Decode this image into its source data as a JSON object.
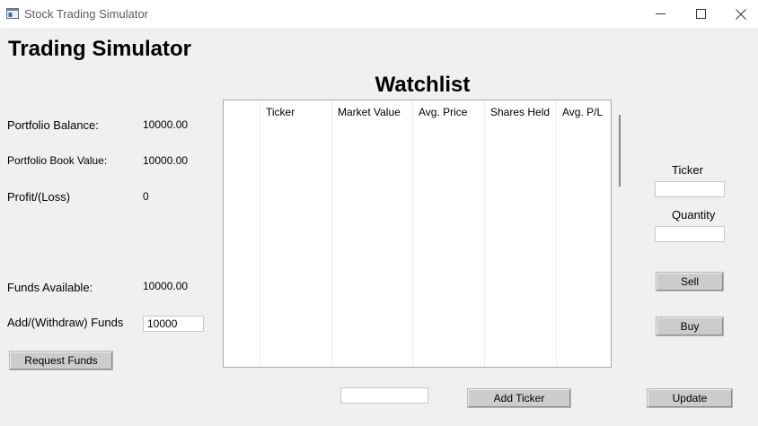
{
  "window": {
    "title": "Stock Trading Simulator",
    "icon": "app-window-icon",
    "controls": [
      "minimize-icon",
      "maximize-icon",
      "close-icon"
    ]
  },
  "header": {
    "title": "Trading Simulator"
  },
  "portfolio": {
    "balance_label": "Portfolio Balance:",
    "balance_value": "10000.00",
    "book_value_label": "Portfolio Book Value:",
    "book_value_value": "10000.00",
    "profit_label": "Profit/(Loss)",
    "profit_value": "0"
  },
  "funds": {
    "available_label": "Funds Available:",
    "available_value": "10000.00",
    "add_withdraw_label": "Add/(Withdraw) Funds",
    "add_withdraw_value": "10000",
    "request_button": "Request Funds"
  },
  "watchlist": {
    "title": "Watchlist",
    "columns": [
      "Ticker",
      "Market Value",
      "Avg. Price",
      "Shares Held",
      "Avg. P/L"
    ],
    "rows": []
  },
  "trade": {
    "ticker_label": "Ticker",
    "ticker_value": "",
    "quantity_label": "Quantity",
    "quantity_value": "",
    "sell_button": "Sell",
    "buy_button": "Buy"
  },
  "bottom": {
    "new_ticker_value": "",
    "add_ticker_button": "Add Ticker",
    "update_button": "Update"
  },
  "colors": {
    "background": "#f0f0f0",
    "button": "#cccccc",
    "titlebar": "#ffffff"
  }
}
